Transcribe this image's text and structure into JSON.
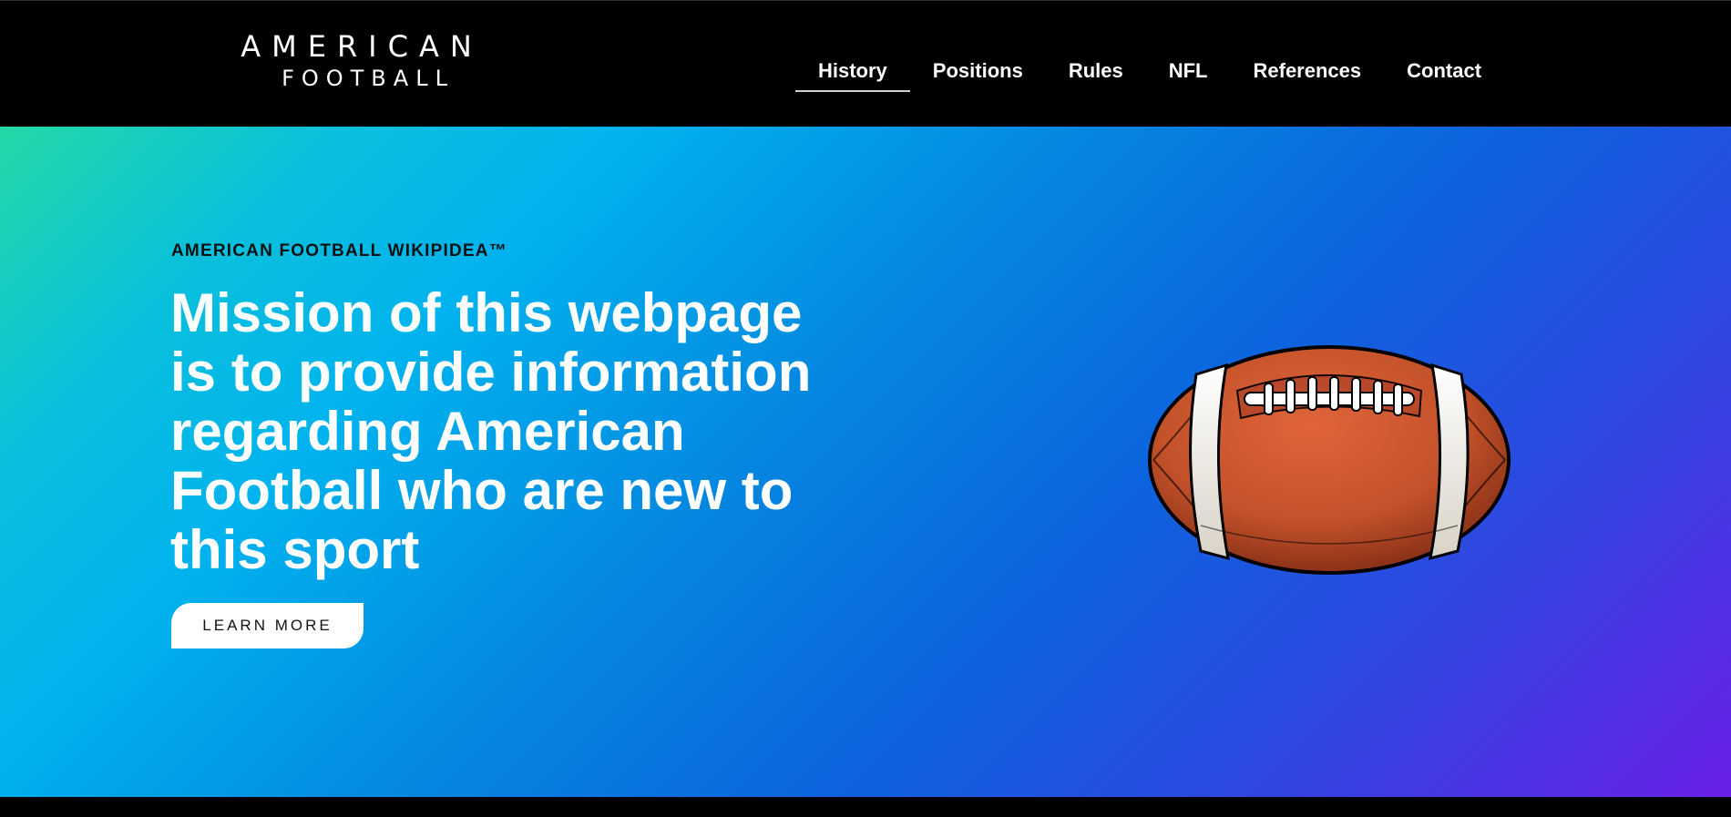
{
  "logo": {
    "line1": "AMERICAN",
    "line2": "FOOTBALL"
  },
  "nav": {
    "items": [
      {
        "label": "History",
        "active": true
      },
      {
        "label": "Positions"
      },
      {
        "label": "Rules"
      },
      {
        "label": "NFL"
      },
      {
        "label": "References"
      },
      {
        "label": "Contact"
      }
    ]
  },
  "hero": {
    "eyebrow": "AMERICAN FOOTBALL WIKIPIDEA™",
    "headline": "Mission of this webpage is to provide information regarding American Football who are new to this sport",
    "cta_label": "LEARN MORE",
    "image_icon": "football-icon"
  },
  "colors": {
    "nav_bg": "#000000",
    "gradient_start": "#23d9a6",
    "gradient_mid": "#0c64de",
    "gradient_end": "#6a1fe8",
    "ball_brown": "#c4522a"
  }
}
